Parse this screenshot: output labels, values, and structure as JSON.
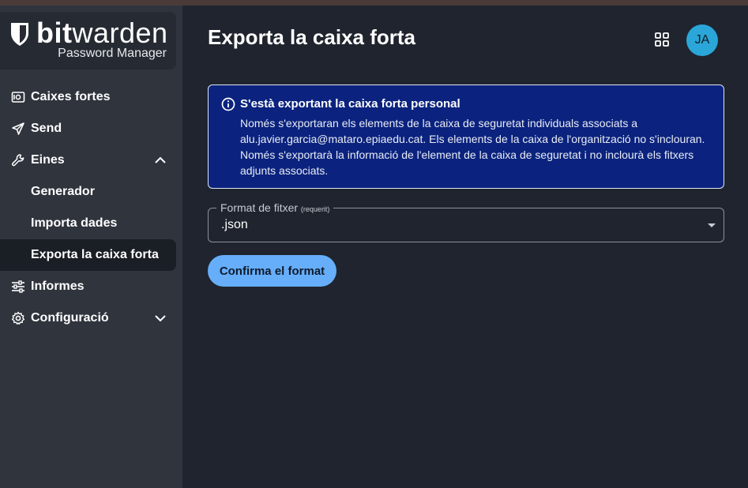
{
  "app": {
    "brand_bold": "bit",
    "brand_light": "warden",
    "brand_sub": "Password Manager"
  },
  "sidebar": {
    "items": [
      {
        "label": "Caixes fortes",
        "icon": "vault-icon"
      },
      {
        "label": "Send",
        "icon": "send-icon"
      },
      {
        "label": "Eines",
        "icon": "wrench-icon",
        "expanded": true
      },
      {
        "label": "Generador"
      },
      {
        "label": "Importa dades"
      },
      {
        "label": "Exporta la caixa forta",
        "active": true
      },
      {
        "label": "Informes",
        "icon": "sliders-icon"
      },
      {
        "label": "Configuració",
        "icon": "gear-icon",
        "expanded": false
      }
    ]
  },
  "header": {
    "title": "Exporta la caixa forta",
    "avatar_initials": "JA"
  },
  "callout": {
    "title": "S'està exportant la caixa forta personal",
    "body": "Només s'exportaran els elements de la caixa de seguretat individuals associats a alu.javier.garcia@mataro.epiaedu.cat. Els elements de la caixa de l'organització no s'inclouran. Només s'exportarà la informació de l'element de la caixa de seguretat i no inclourà els fitxers adjunts associats."
  },
  "form": {
    "format_label": "Format de fitxer",
    "format_required": "(requerit)",
    "format_value": ".json",
    "confirm_label": "Confirma el format"
  },
  "colors": {
    "accent": "#66aef9",
    "callout_bg": "#0b237e",
    "avatar_bg": "#2aa6d8"
  }
}
